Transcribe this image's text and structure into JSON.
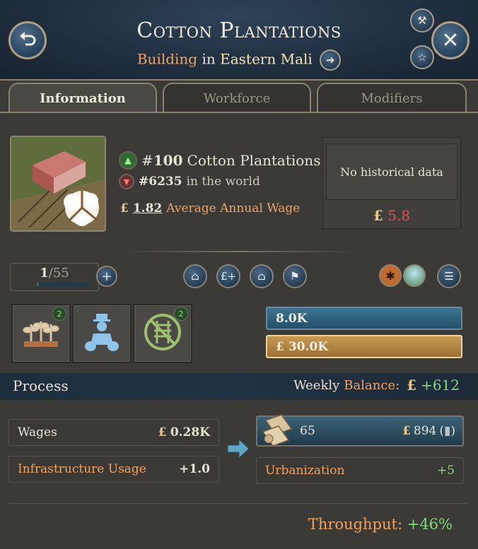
{
  "header": {
    "title": "Cotton Plantations",
    "subtitle_type": "Building",
    "subtitle_in": "in",
    "subtitle_location": "Eastern Mali"
  },
  "tabs": [
    {
      "label": "Information"
    },
    {
      "label": "Workforce"
    },
    {
      "label": "Modifiers"
    }
  ],
  "info": {
    "rank_prefix": "#",
    "rank_value": "100",
    "rank_label": "Cotton Plantations",
    "world_rank": "#6235",
    "world_label": "in the world",
    "currency": "£",
    "wage_value": "1.82",
    "wage_label": "Average Annual Wage",
    "history_text": "No historical data",
    "history_value": "5.8"
  },
  "levels": {
    "current": "1",
    "separator": "/",
    "max": "55",
    "fill_fraction": 0.02
  },
  "slots": [
    {
      "name": "crops",
      "badge": "2"
    },
    {
      "name": "worker",
      "badge": ""
    },
    {
      "name": "no-railroad",
      "badge": "2"
    }
  ],
  "bars": {
    "blue_value": "8.0K",
    "gold_value": "30.0K"
  },
  "process": {
    "title": "Process",
    "weekly": "Weekly",
    "balance": "Balance:",
    "balance_value": "+612",
    "wages_label": "Wages",
    "wages_value": "0.28K",
    "infra_label": "Infrastructure Usage",
    "infra_value": "+1.0",
    "output_qty": "65",
    "output_price": "894",
    "urban_label": "Urbanization",
    "urban_value": "+5",
    "throughput_label": "Throughput:",
    "throughput_value": "+46%"
  },
  "colors": {
    "accent_orange": "#f0a35e",
    "positive_green": "#7fdc7a",
    "negative_red": "#e0524f",
    "bar_blue": "#2b5a74",
    "bar_gold": "#b88945"
  }
}
